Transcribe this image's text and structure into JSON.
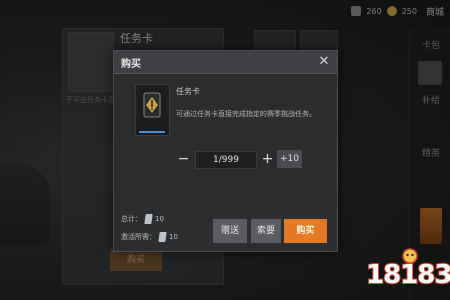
{
  "background": {
    "left_panel_title": "任务卡",
    "left_panel_sub": "不可由任务卡直接完成",
    "bottom_button": "购买",
    "top_bar": {
      "currency1": "260",
      "currency2": "250",
      "label": "商城"
    },
    "right_nav": [
      "卡包",
      "补给",
      "精英"
    ]
  },
  "dialog": {
    "title": "购买",
    "close_icon": "close-icon",
    "item": {
      "name": "任务卡",
      "description": "可通过任务卡直接完成指定的赛季挑战任务。",
      "icon": "exclamation-card-icon",
      "accent_color": "#4d8fd6"
    },
    "quantity": {
      "minus": "−",
      "value": "1/999",
      "plus": "+",
      "add10": "+10"
    },
    "total": {
      "label": "总计：",
      "value": "10"
    },
    "owned": {
      "label": "激活所需：",
      "value": "10"
    },
    "buttons": {
      "gift": "赠送",
      "request": "索要",
      "buy": "购买"
    },
    "colors": {
      "buy_button": "#e57a24",
      "secondary_button": "#5a5c5f"
    }
  },
  "watermark": {
    "text": "18183"
  }
}
